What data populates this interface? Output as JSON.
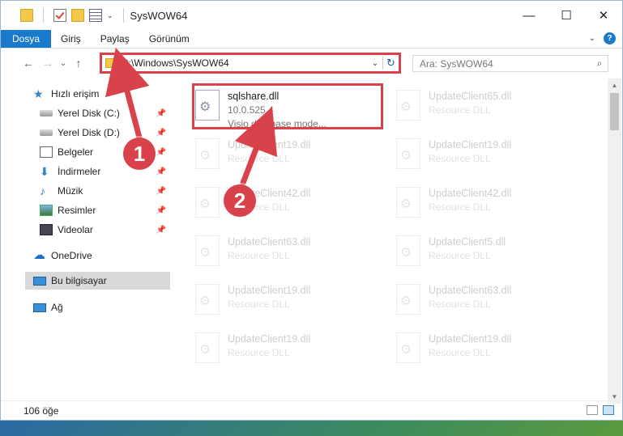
{
  "window": {
    "title": "SysWOW64",
    "controls": {
      "minimize": "—",
      "maximize": "☐",
      "close": "✕"
    }
  },
  "ribbon": {
    "tabs": [
      "Dosya",
      "Giriş",
      "Paylaş",
      "Görünüm"
    ],
    "collapse": "⌄",
    "help": "?"
  },
  "nav": {
    "back": "←",
    "forward": "→",
    "recent": "⌄",
    "up": "↑",
    "address": "C:\\Windows\\SysWOW64",
    "address_dropdown": "⌄",
    "refresh": "↻",
    "search_placeholder": "Ara: SysWOW64",
    "search_icon": "⌕"
  },
  "sidebar": {
    "items": [
      {
        "label": "Hızlı erişim",
        "icon": "star-icon"
      },
      {
        "label": "Yerel Disk (C:)",
        "icon": "disk-icon",
        "pinned": true
      },
      {
        "label": "Yerel Disk (D:)",
        "icon": "disk-icon",
        "pinned": true
      },
      {
        "label": "Belgeler",
        "icon": "documents-icon",
        "pinned": true
      },
      {
        "label": "İndirmeler",
        "icon": "download-icon",
        "pinned": true
      },
      {
        "label": "Müzik",
        "icon": "music-icon",
        "pinned": true
      },
      {
        "label": "Resimler",
        "icon": "pictures-icon",
        "pinned": true
      },
      {
        "label": "Videolar",
        "icon": "videos-icon",
        "pinned": true
      },
      {
        "label": "OneDrive",
        "icon": "onedrive-icon"
      },
      {
        "label": "Bu bilgisayar",
        "icon": "computer-icon",
        "selected": true
      },
      {
        "label": "Ağ",
        "icon": "network-icon"
      }
    ],
    "pin_glyph": "📌",
    "star_glyph": "★",
    "download_glyph": "⬇",
    "music_glyph": "♪",
    "cloud_glyph": "☁"
  },
  "files": {
    "main": {
      "name": "sqlshare.dll",
      "version": "10.0.525.4",
      "description": "Visio database mode..."
    },
    "ghost": [
      {
        "name": "UpdateClient65.dll",
        "sub": "Resource DLL"
      },
      {
        "name": "UpdateClient19.dll",
        "sub": "Resource DLL"
      },
      {
        "name": "UpdateClient19.dll",
        "sub": "Resource DLL"
      },
      {
        "name": "UpdateClient42.dll",
        "sub": "Resource DLL"
      },
      {
        "name": "UpdateClient42.dll",
        "sub": "Resource DLL"
      },
      {
        "name": "UpdateClient63.dll",
        "sub": "Resource DLL"
      },
      {
        "name": "UpdateClient5.dll",
        "sub": "Resource DLL"
      },
      {
        "name": "UpdateClient19.dll",
        "sub": "Resource DLL"
      },
      {
        "name": "UpdateClient63.dll",
        "sub": "Resource DLL"
      },
      {
        "name": "UpdateClient19.dll",
        "sub": "Resource DLL"
      },
      {
        "name": "UpdateClient19.dll",
        "sub": "Resource DLL"
      }
    ]
  },
  "status": {
    "count": "106 öğe"
  },
  "scroll": {
    "up": "▲",
    "down": "▼"
  },
  "annotations": {
    "step1": "1",
    "step2": "2",
    "color": "#d9424a"
  }
}
